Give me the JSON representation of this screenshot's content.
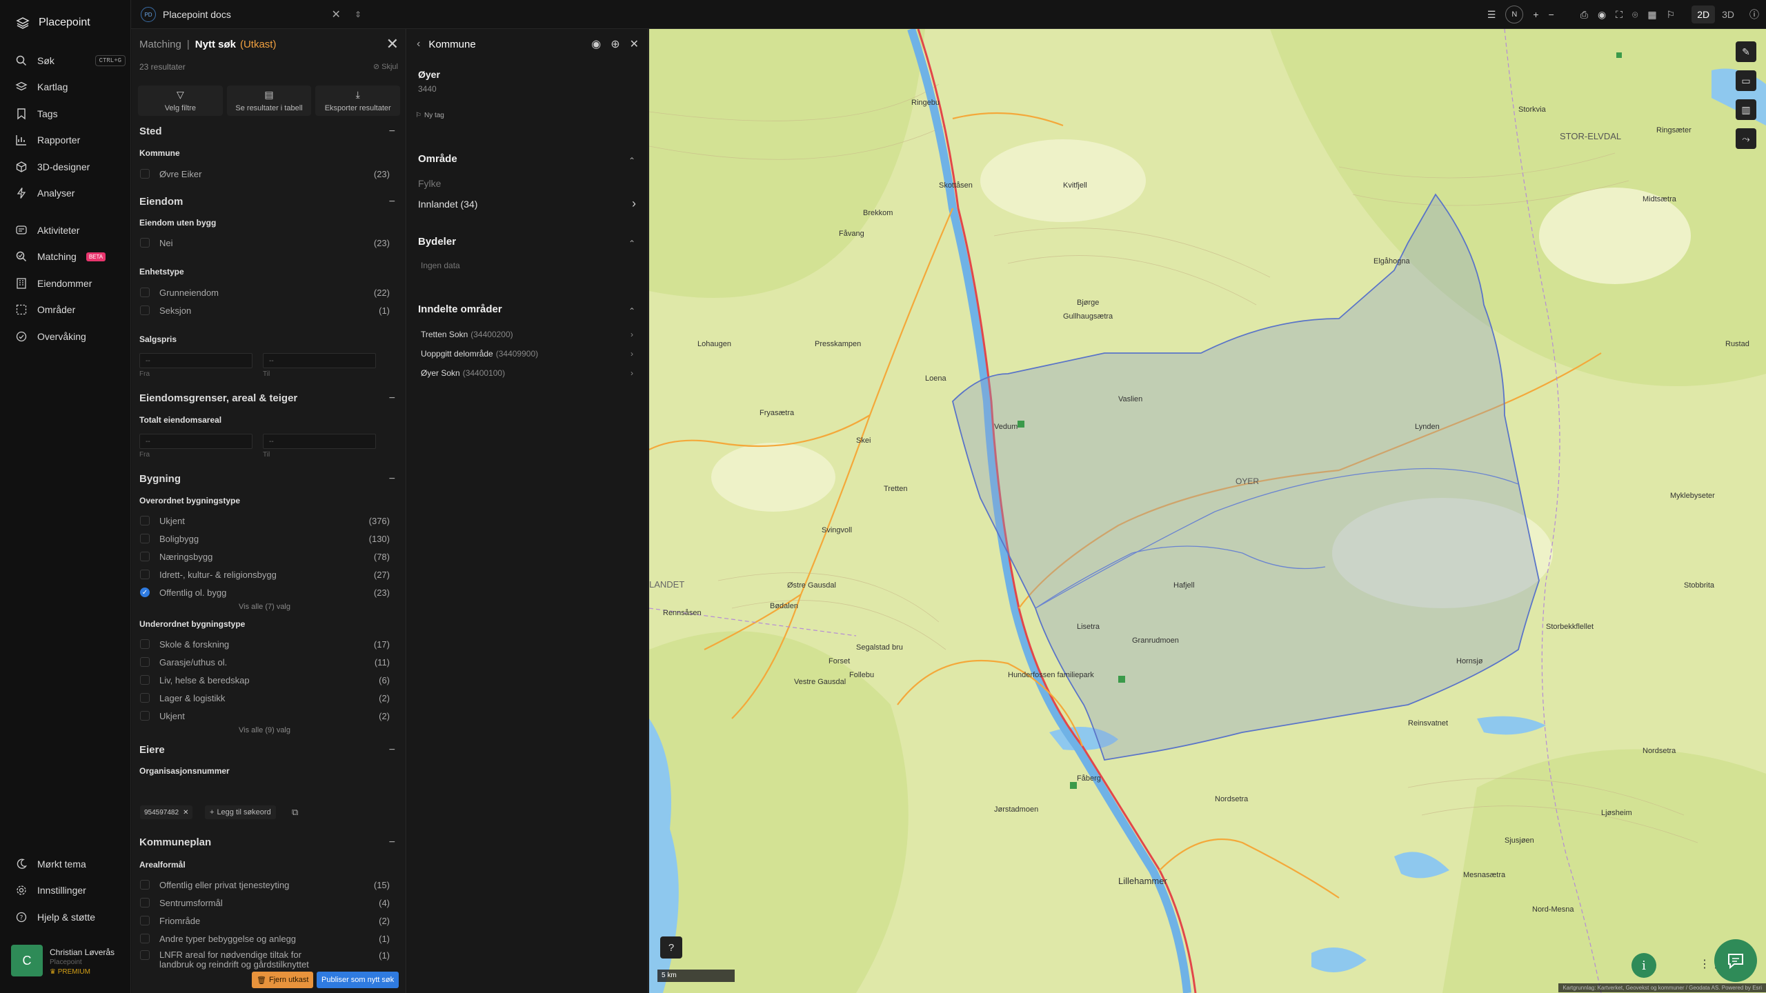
{
  "app": {
    "name": "Placepoint"
  },
  "nav": {
    "items": [
      {
        "label": "Søk",
        "shortcut": "CTRL+G",
        "icon": "search-icon"
      },
      {
        "label": "Kartlag",
        "icon": "layers-icon"
      },
      {
        "label": "Tags",
        "icon": "bookmark-icon"
      },
      {
        "label": "Rapporter",
        "icon": "chart-icon"
      },
      {
        "label": "3D-designer",
        "icon": "cube-icon"
      },
      {
        "label": "Analyser",
        "icon": "bolt-icon"
      },
      {
        "label": "Aktiviteter",
        "icon": "activity-icon"
      },
      {
        "label": "Matching",
        "badge": "BETA",
        "icon": "match-icon"
      },
      {
        "label": "Eiendommer",
        "icon": "building-icon"
      },
      {
        "label": "Områder",
        "icon": "area-icon"
      },
      {
        "label": "Overvåking",
        "icon": "monitor-icon"
      }
    ],
    "bottom": [
      {
        "label": "Mørkt tema",
        "icon": "moon-icon"
      },
      {
        "label": "Innstillinger",
        "icon": "gear-icon"
      },
      {
        "label": "Hjelp & støtte",
        "icon": "help-icon"
      }
    ],
    "user": {
      "initial": "C",
      "name": "Christian Løverås",
      "org": "Placepoint",
      "plan": "PREMIUM"
    }
  },
  "topbar": {
    "doc_badge": "PD",
    "doc_name": "Placepoint docs",
    "compass": "N",
    "mode_2d": "2D",
    "mode_3d": "3D"
  },
  "filter": {
    "crumb": "Matching",
    "title": "Nytt søk",
    "draft": "(Utkast)",
    "result_count": "23 resultater",
    "hide": "Skjul",
    "actions": [
      "Velg filtre",
      "Se resultater i tabell",
      "Eksporter resultater"
    ],
    "sections": {
      "sted": "Sted",
      "kommune_label": "Kommune",
      "kommune": [
        {
          "label": "Øvre Eiker",
          "count": "(23)"
        }
      ],
      "eiendom": "Eiendom",
      "uten_bygg_label": "Eiendom uten bygg",
      "uten_bygg": [
        {
          "label": "Nei",
          "count": "(23)"
        }
      ],
      "enhetstype_label": "Enhetstype",
      "enhetstype": [
        {
          "label": "Grunneiendom",
          "count": "(22)"
        },
        {
          "label": "Seksjon",
          "count": "(1)"
        }
      ],
      "salgspris_label": "Salgspris",
      "from": "Fra",
      "to": "Til",
      "placeholder": "--",
      "grenser": "Eiendomsgrenser, areal & teiger",
      "totalt_label": "Totalt eiendomsareal",
      "bygning": "Bygning",
      "overordnet_label": "Overordnet bygningstype",
      "overordnet": [
        {
          "label": "Ukjent",
          "count": "(376)",
          "checked": false
        },
        {
          "label": "Boligbygg",
          "count": "(130)",
          "checked": false
        },
        {
          "label": "Næringsbygg",
          "count": "(78)",
          "checked": false
        },
        {
          "label": "Idrett-, kultur- & religionsbygg",
          "count": "(27)",
          "checked": false
        },
        {
          "label": "Offentlig ol. bygg",
          "count": "(23)",
          "checked": true
        }
      ],
      "overordnet_more": "Vis alle (7) valg",
      "underordnet_label": "Underordnet bygningstype",
      "underordnet": [
        {
          "label": "Skole & forskning",
          "count": "(17)"
        },
        {
          "label": "Garasje/uthus ol.",
          "count": "(11)"
        },
        {
          "label": "Liv, helse & beredskap",
          "count": "(6)"
        },
        {
          "label": "Lager & logistikk",
          "count": "(2)"
        },
        {
          "label": "Ukjent",
          "count": "(2)"
        }
      ],
      "underordnet_more": "Vis alle (9) valg",
      "eiere": "Eiere",
      "orgnr_label": "Organisasjonsnummer",
      "orgnr_chip": "954597482",
      "add_keyword": "Legg til søkeord",
      "kommuneplan": "Kommuneplan",
      "arealformal_label": "Arealformål",
      "arealformal": [
        {
          "label": "Offentlig eller privat tjenesteyting",
          "count": "(15)"
        },
        {
          "label": "Sentrumsformål",
          "count": "(4)"
        },
        {
          "label": "Friområde",
          "count": "(2)"
        },
        {
          "label": "Andre typer bebyggelse og anlegg",
          "count": "(1)"
        },
        {
          "label": "LNFR areal for nødvendige tiltak for landbruk og reindrift og gårdstilknyttet næringsvirksomhet basert på gårdens ressursgrunnlag",
          "count": "(1)"
        }
      ]
    },
    "remove_draft": "Fjern utkast",
    "publish": "Publiser som nytt søk"
  },
  "detail": {
    "title": "Kommune",
    "name": "Øyer",
    "code": "3440",
    "new_tag": "Ny tag",
    "omrade": "Område",
    "fylke_label": "Fylke",
    "fylke_value": "Innlandet (34)",
    "bydeler": "Bydeler",
    "no_data": "Ingen data",
    "inndelte": "Inndelte områder",
    "sub_areas": [
      {
        "name": "Tretten Sokn",
        "code": "(34400200)"
      },
      {
        "name": "Uoppgitt delområde",
        "code": "(34409900)"
      },
      {
        "name": "Øyer Sokn",
        "code": "(34400100)"
      }
    ]
  },
  "map": {
    "places": [
      "Ringebu",
      "STOR-ELVDAL",
      "Kvitfjell",
      "Skottåsen",
      "Brekkom",
      "Fåvang",
      "Gullhaugsætra",
      "Elgåhogna",
      "Bjørge",
      "Tretten",
      "OYER",
      "Svingvoll",
      "Hafjell",
      "Lisetra",
      "Granrudmoen",
      "Hunderfossen familiepark",
      "Follebu",
      "Segalstad bru",
      "Fåberg",
      "Jørstadmoen",
      "Lillehammer",
      "Nordsetra",
      "Mesnasætra",
      "Skei",
      "Østre Gausdal",
      "Vestre Gausdal",
      "Forset",
      "Bødalen",
      "Lynden",
      "Myklebyseter",
      "Storbekkflellet",
      "Stobbrita",
      "Hornsjø",
      "Reinsvatnet",
      "LANDET",
      "Sjusjøen",
      "Ljøsheim",
      "Storkvia",
      "Nordsetra",
      "Vedum",
      "Vaslien",
      "Loena",
      "Presskampen",
      "Lohaugen",
      "Fryasætra",
      "Rustad",
      "Rennsåsen",
      "Nord-Mesna",
      "Ringsæter",
      "Midtsætra"
    ],
    "scale": "5 km",
    "attribution": "Kartgrunnlag: Kartverket, Geovekst og kommuner / Geodata AS. Powered by Esri"
  },
  "colors": {
    "accent": "#2f7be0",
    "draft": "#f0a040",
    "brand_green": "#2f8b58",
    "beta": "#e8356d"
  }
}
